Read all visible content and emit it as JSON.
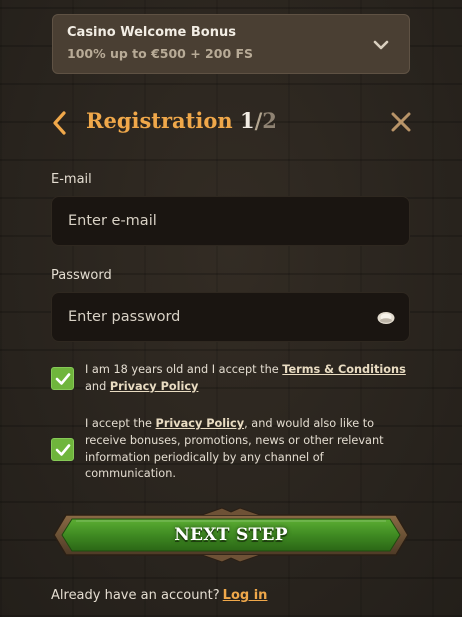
{
  "bonus": {
    "title": "Casino Welcome Bonus",
    "subtitle": "100% up to €500 + 200 FS",
    "icon": "chevron-down-icon"
  },
  "header": {
    "title": "Registration",
    "step_current": "1",
    "step_separator": "/",
    "step_total": "2",
    "back_icon": "chevron-left-icon",
    "close_icon": "close-icon",
    "accent_color": "#f0a84a"
  },
  "form": {
    "email": {
      "label": "E-mail",
      "placeholder": "Enter e-mail",
      "value": ""
    },
    "password": {
      "label": "Password",
      "placeholder": "Enter password",
      "value": "",
      "icon": "eye-icon"
    }
  },
  "consents": {
    "age": {
      "checked": true,
      "text_1": "I am 18 years old and I accept the ",
      "link_terms": "Terms & Conditions",
      "text_2": " and ",
      "link_privacy": "Privacy Policy"
    },
    "marketing": {
      "checked": true,
      "text_1": "I accept the ",
      "link_privacy": "Privacy Policy",
      "text_2": ", and would also like to receive bonuses, promotions, news or other relevant information periodically by any channel of communication."
    },
    "check_color": "#6fb53c"
  },
  "actions": {
    "next_label": "NEXT STEP",
    "button_color": "#3f8a22"
  },
  "footer": {
    "text": "Already have an account?",
    "login_link": "Log in"
  }
}
